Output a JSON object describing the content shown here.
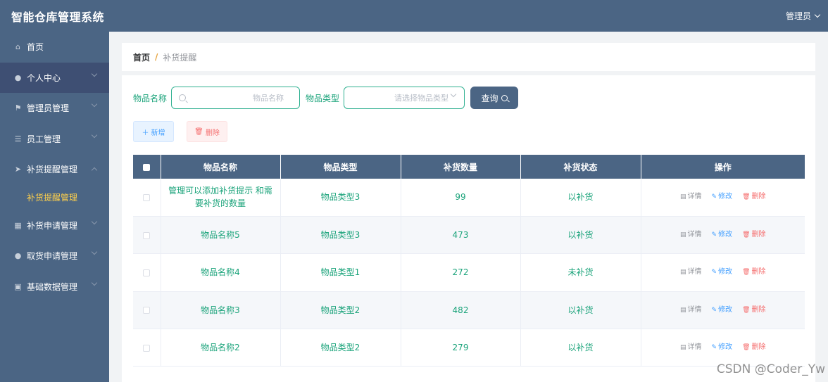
{
  "app": {
    "title": "智能仓库管理系统",
    "user_label": "管理员"
  },
  "sidebar": {
    "items": [
      {
        "label": "首页",
        "icon": "home-icon",
        "glyph": "⌂"
      },
      {
        "label": "个人中心",
        "icon": "user-icon",
        "glyph": "●"
      },
      {
        "label": "管理员管理",
        "icon": "flag-icon",
        "glyph": "⚑"
      },
      {
        "label": "员工管理",
        "icon": "sliders-icon",
        "glyph": "☰"
      },
      {
        "label": "补货提醒管理",
        "icon": "send-icon",
        "glyph": "➤"
      },
      {
        "label": "补货申请管理",
        "icon": "grid-icon",
        "glyph": "▦"
      },
      {
        "label": "取货申请管理",
        "icon": "location-icon",
        "glyph": "●"
      },
      {
        "label": "基础数据管理",
        "icon": "clipboard-icon",
        "glyph": "▣"
      }
    ],
    "submenu": {
      "label": "补货提醒管理"
    }
  },
  "breadcrumb": {
    "home": "首页",
    "separator": "/",
    "current": "补货提醒"
  },
  "search": {
    "name_label": "物品名称",
    "name_placeholder": "物品名称",
    "type_label": "物品类型",
    "type_placeholder": "请选择物品类型",
    "query_button": "查询"
  },
  "actions": {
    "add": "新增",
    "delete": "删除"
  },
  "table": {
    "headers": [
      "物品名称",
      "物品类型",
      "补货数量",
      "补货状态",
      "操作"
    ],
    "rows": [
      {
        "name": "管理可以添加补货提示 和需要补货的数量",
        "type": "物品类型3",
        "qty": "99",
        "status": "以补货"
      },
      {
        "name": "物品名称5",
        "type": "物品类型3",
        "qty": "473",
        "status": "以补货"
      },
      {
        "name": "物品名称4",
        "type": "物品类型1",
        "qty": "272",
        "status": "未补货"
      },
      {
        "name": "物品名称3",
        "type": "物品类型2",
        "qty": "482",
        "status": "以补货"
      },
      {
        "name": "物品名称2",
        "type": "物品类型2",
        "qty": "279",
        "status": "以补货"
      }
    ],
    "ops": {
      "detail": "详情",
      "edit": "修改",
      "delete": "删除"
    }
  },
  "watermark": "CSDN @Coder_Yw",
  "colors": {
    "primary": "#4b6584",
    "accent_green": "#1aa37a",
    "submenu_active": "#ffd04b",
    "danger": "#f56c6c",
    "info": "#409eff"
  }
}
